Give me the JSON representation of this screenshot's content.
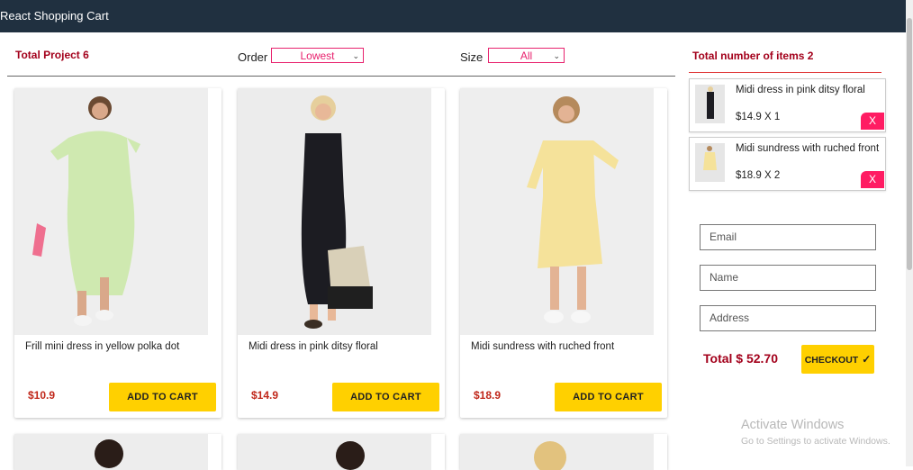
{
  "app": {
    "title": "React Shopping Cart"
  },
  "filters": {
    "total_label": "Total Project 6",
    "order_label": "Order",
    "order_value": "Lowest",
    "size_label": "Size",
    "size_value": "All"
  },
  "products": [
    {
      "name": "Frill mini dress in yellow polka dot",
      "price": "$10.9",
      "button": "ADD TO CART"
    },
    {
      "name": "Midi dress in pink ditsy floral",
      "price": "$14.9",
      "button": "ADD TO CART"
    },
    {
      "name": "Midi sundress with ruched front",
      "price": "$18.9",
      "button": "ADD TO CART"
    }
  ],
  "cart": {
    "header": "Total number of items 2",
    "items": [
      {
        "name": "Midi dress in pink ditsy floral",
        "price_qty": "$14.9 X 1",
        "remove": "X"
      },
      {
        "name": "Midi sundress with ruched front",
        "price_qty": "$18.9 X 2",
        "remove": "X"
      }
    ],
    "form": {
      "email_placeholder": "Email",
      "name_placeholder": "Name",
      "address_placeholder": "Address"
    },
    "total": "Total $ 52.70",
    "checkout_label": "CHECKOUT",
    "checkout_icon": "check-icon"
  },
  "watermark": {
    "line1": "Activate Windows",
    "line2": "Go to Settings to activate Windows."
  },
  "colors": {
    "topbar": "#203040",
    "accent_red": "#a3001b",
    "button_yellow": "#ffd000",
    "remove_pink": "#ff1c63",
    "select_pink": "#e8226e"
  }
}
